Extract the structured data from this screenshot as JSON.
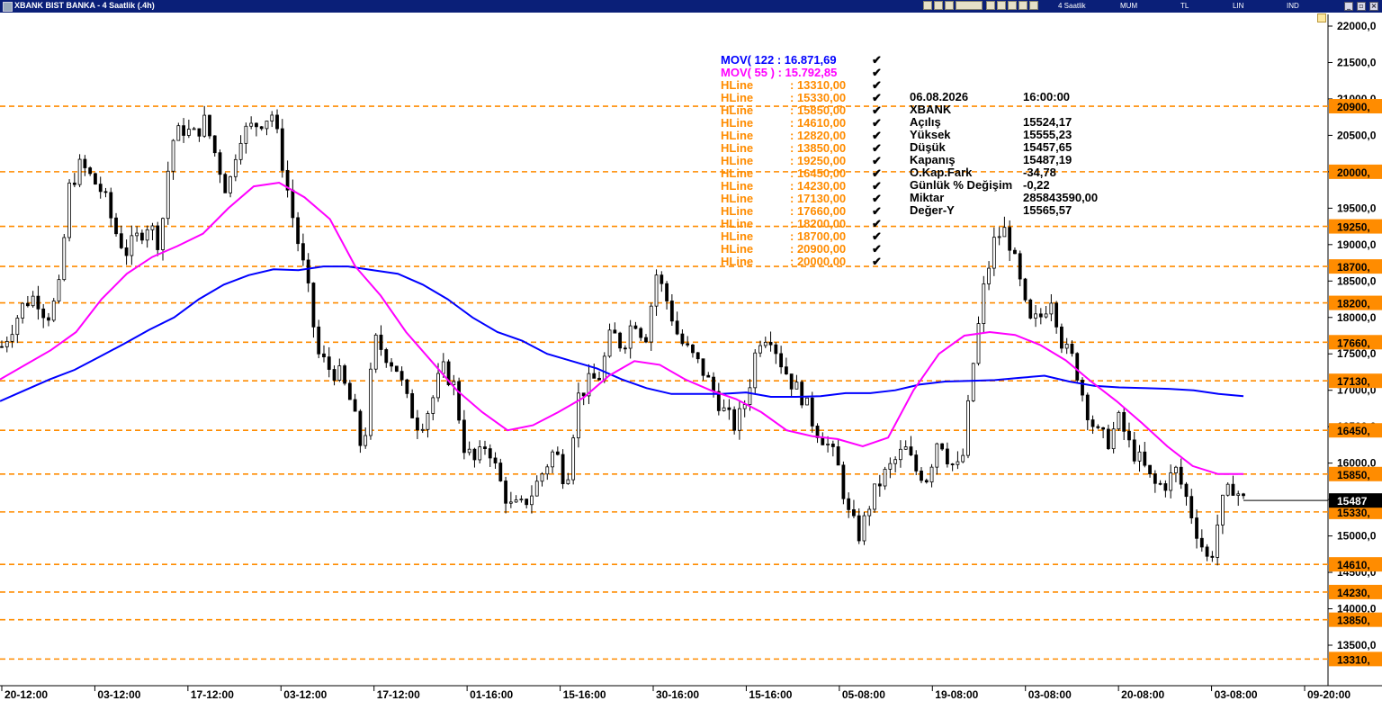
{
  "window": {
    "title": "XBANK BIST BANKA - 4 Saatlik (.4h)",
    "period_label": "4 Saatlik",
    "menu_labels": [
      "MUM",
      "TL",
      "LIN",
      "IND"
    ]
  },
  "legend": [
    {
      "name": "MOV( 122 : 16.871,69",
      "color": "#0000ff"
    },
    {
      "name": "MOV( 55 ) : 15.792,85",
      "color": "#ff00ff"
    },
    {
      "name": "HLine",
      "value": ": 13310,00",
      "color": "#ff8c00"
    },
    {
      "name": "HLine",
      "value": ": 15330,00",
      "color": "#ff8c00"
    },
    {
      "name": "HLine",
      "value": ": 15850,00",
      "color": "#ff8c00"
    },
    {
      "name": "HLine",
      "value": ": 14610,00",
      "color": "#ff8c00"
    },
    {
      "name": "HLine",
      "value": ": 12820,00",
      "color": "#ff8c00"
    },
    {
      "name": "HLine",
      "value": ": 13850,00",
      "color": "#ff8c00"
    },
    {
      "name": "HLine",
      "value": ": 19250,00",
      "color": "#ff8c00"
    },
    {
      "name": "HLine",
      "value": ": 16450,00",
      "color": "#ff8c00"
    },
    {
      "name": "HLine",
      "value": ": 14230,00",
      "color": "#ff8c00"
    },
    {
      "name": "HLine",
      "value": ": 17130,00",
      "color": "#ff8c00"
    },
    {
      "name": "HLine",
      "value": ": 17660,00",
      "color": "#ff8c00"
    },
    {
      "name": "HLine",
      "value": ": 18200,00",
      "color": "#ff8c00"
    },
    {
      "name": "HLine",
      "value": ": 18700,00",
      "color": "#ff8c00"
    },
    {
      "name": "HLine",
      "value": ": 20900,00",
      "color": "#ff8c00"
    },
    {
      "name": "HLine",
      "value": ": 20000,00",
      "color": "#ff8c00"
    }
  ],
  "info_box": {
    "date": "06.08.2026",
    "time": "16:00:00",
    "symbol": "XBANK",
    "rows": [
      {
        "label": "Açılış",
        "value": "15524,17"
      },
      {
        "label": "Yüksek",
        "value": "15555,23"
      },
      {
        "label": "Düşük",
        "value": "15457,65"
      },
      {
        "label": "Kapanış",
        "value": "15487,19"
      },
      {
        "label": "O.Kap.Fark",
        "value": "-34,78"
      },
      {
        "label": "Günlük % Değişim",
        "value": "-0,22"
      },
      {
        "label": "Miktar",
        "value": "285843590,00"
      },
      {
        "label": "Değer-Y",
        "value": "15565,57"
      }
    ]
  },
  "colors": {
    "hline": "#ff8c00",
    "mov122": "#0000ff",
    "mov55": "#ff00ff",
    "candle": "#000000",
    "titlebar": "#0a1f78"
  },
  "chart_data": {
    "type": "candlestick",
    "title": "XBANK BIST BANKA - 4 Saatlik (.4h)",
    "ylim": [
      13200,
      22300
    ],
    "y_ticks": [
      22000,
      21500,
      21000,
      20500,
      20000,
      19500,
      19000,
      18500,
      18000,
      17500,
      17000,
      16500,
      16000,
      15500,
      15000,
      14500,
      14000,
      13500
    ],
    "y_tick_labels": [
      "22000,0",
      "21500,0",
      "21000,0",
      "20500,0",
      "20000,0",
      "19500,0",
      "19000,0",
      "18500,0",
      "18000,0",
      "17500,0",
      "17000,0",
      "16500,0",
      "16000,0",
      "15500,0",
      "15000,0",
      "14500,0",
      "14000,0",
      "13500,0"
    ],
    "x_labels": [
      "20-12:00",
      "03-12:00",
      "17-12:00",
      "03-12:00",
      "17-12:00",
      "01-16:00",
      "15-16:00",
      "30-16:00",
      "15-16:00",
      "05-08:00",
      "19-08:00",
      "03-08:00",
      "20-08:00",
      "03-08:00",
      "09-20:00"
    ],
    "hlines": [
      {
        "value": 20900,
        "label": "20900,"
      },
      {
        "value": 20000,
        "label": "20000,"
      },
      {
        "value": 19250,
        "label": "19250,"
      },
      {
        "value": 18700,
        "label": "18700,"
      },
      {
        "value": 18200,
        "label": "18200,"
      },
      {
        "value": 17660,
        "label": "17660,"
      },
      {
        "value": 17130,
        "label": "17130,"
      },
      {
        "value": 16450,
        "label": "16450,"
      },
      {
        "value": 15850,
        "label": "15850,"
      },
      {
        "value": 15330,
        "label": "15330,"
      },
      {
        "value": 14610,
        "label": "14610,"
      },
      {
        "value": 14230,
        "label": "14230,"
      },
      {
        "value": 13850,
        "label": "13850,"
      },
      {
        "value": 13310,
        "label": "13310,"
      }
    ],
    "last_price": {
      "value": 15487,
      "label": "15487"
    },
    "price_path": [
      17600,
      17900,
      18200,
      18300,
      18000,
      18300,
      19800,
      20100,
      19900,
      19700,
      19200,
      18900,
      19100,
      19300,
      19000,
      20400,
      20600,
      20500,
      20700,
      20200,
      19700,
      20500,
      20600,
      20700,
      20800,
      20000,
      19200,
      18500,
      17500,
      17300,
      17200,
      16800,
      16100,
      17700,
      17500,
      17300,
      16800,
      16500,
      16800,
      17300,
      17100,
      16200,
      16000,
      16300,
      15800,
      15400,
      15400,
      15600,
      15900,
      16200,
      15700,
      16900,
      17100,
      17200,
      17800,
      17600,
      18000,
      17700,
      18600,
      18200,
      17700,
      17500,
      17300,
      17000,
      16700,
      16500,
      16900,
      17700,
      17800,
      17400,
      17100,
      16900,
      16500,
      16300,
      16000,
      15300,
      15000,
      15500,
      15800,
      16000,
      16200,
      15900,
      15800,
      16400,
      16000,
      15900,
      17300,
      18400,
      19100,
      19200,
      18600,
      17900,
      18000,
      18300,
      17600,
      17400,
      16800,
      16400,
      16300,
      16600,
      16200,
      16000,
      15700,
      15700,
      15900,
      15500,
      15000,
      14600,
      15400,
      15700,
      15487
    ],
    "mov122_path": [
      16850,
      17000,
      17150,
      17280,
      17460,
      17640,
      17830,
      18000,
      18250,
      18450,
      18580,
      18660,
      18650,
      18700,
      18700,
      18650,
      18600,
      18450,
      18250,
      18000,
      17800,
      17680,
      17500,
      17400,
      17300,
      17150,
      17030,
      16950,
      16950,
      16950,
      16970,
      16910,
      16910,
      16920,
      16960,
      16960,
      17000,
      17080,
      17120,
      17130,
      17140,
      17170,
      17200,
      17120,
      17060,
      17040,
      17030,
      17020,
      17000,
      16950,
      16920
    ],
    "mov55_path": [
      17150,
      17350,
      17550,
      17800,
      18250,
      18600,
      18830,
      18980,
      19150,
      19500,
      19800,
      19850,
      19650,
      19350,
      18700,
      18300,
      17800,
      17400,
      17000,
      16700,
      16450,
      16520,
      16700,
      16900,
      17200,
      17400,
      17350,
      17150,
      17000,
      16880,
      16700,
      16450,
      16370,
      16330,
      16230,
      16350,
      17000,
      17500,
      17750,
      17800,
      17760,
      17620,
      17410,
      17120,
      16850,
      16550,
      16230,
      15960,
      15850,
      15850
    ]
  }
}
